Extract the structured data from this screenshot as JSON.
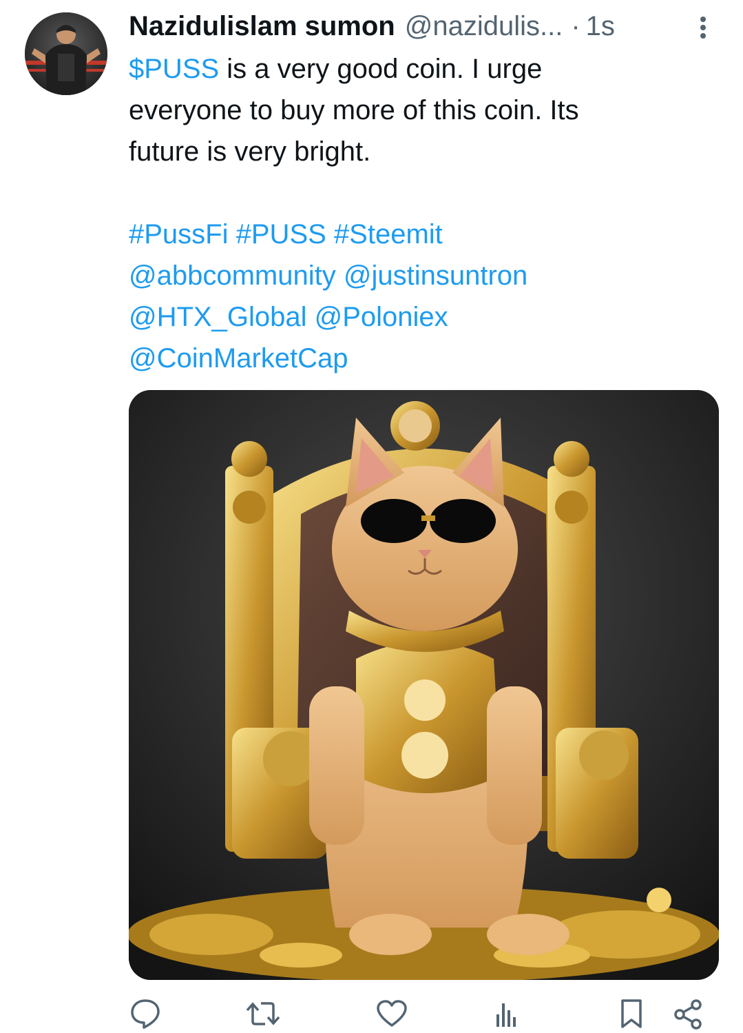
{
  "author": {
    "display_name": "Nazidulislam sumon",
    "handle": "@nazidulis...",
    "separator": "·",
    "timestamp": "1s"
  },
  "tweet": {
    "cashtag": "$PUSS",
    "text_after_cashtag": " is a very good coin. I urge",
    "line2": "everyone to buy more of this coin. Its",
    "line3": "future is very bright.",
    "hashtags": [
      "#PussFi",
      "#PUSS",
      "#Steemit"
    ],
    "mentions_line1": [
      "@abbcommunity",
      "@justinsuntron"
    ],
    "mentions_line2": [
      "@HTX_Global",
      "@Poloniex"
    ],
    "mentions_line3": [
      "@CoinMarketCap"
    ]
  },
  "media": {
    "kind": "photo",
    "subject_icon": "cat-on-golden-throne-photo"
  },
  "actions": {
    "icons": [
      "reply-icon",
      "retweet-icon",
      "like-icon",
      "views-icon",
      "bookmark-icon",
      "share-icon"
    ],
    "color": "#536471"
  },
  "colors": {
    "link": "#1d9bf0",
    "text": "#0f1419",
    "secondary": "#536471"
  }
}
